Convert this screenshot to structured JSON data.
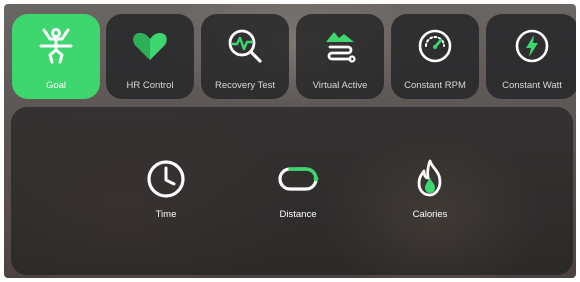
{
  "modes": [
    {
      "label": "Goal",
      "icon": "goal-person-icon",
      "selected": true
    },
    {
      "label": "HR Control",
      "icon": "heart-icon",
      "selected": false
    },
    {
      "label": "Recovery Test",
      "icon": "recovery-magnifier-icon",
      "selected": false
    },
    {
      "label": "Virtual Active",
      "icon": "mountain-route-icon",
      "selected": false
    },
    {
      "label": "Constant RPM",
      "icon": "speedometer-icon",
      "selected": false
    },
    {
      "label": "Constant Watt",
      "icon": "lightning-icon",
      "selected": false
    }
  ],
  "goals": [
    {
      "label": "Time",
      "icon": "clock-icon"
    },
    {
      "label": "Distance",
      "icon": "distance-track-icon"
    },
    {
      "label": "Calories",
      "icon": "flame-icon"
    }
  ],
  "colors": {
    "accent": "#3ed66e",
    "tile_background": "#202022",
    "text": "#ffffff"
  }
}
